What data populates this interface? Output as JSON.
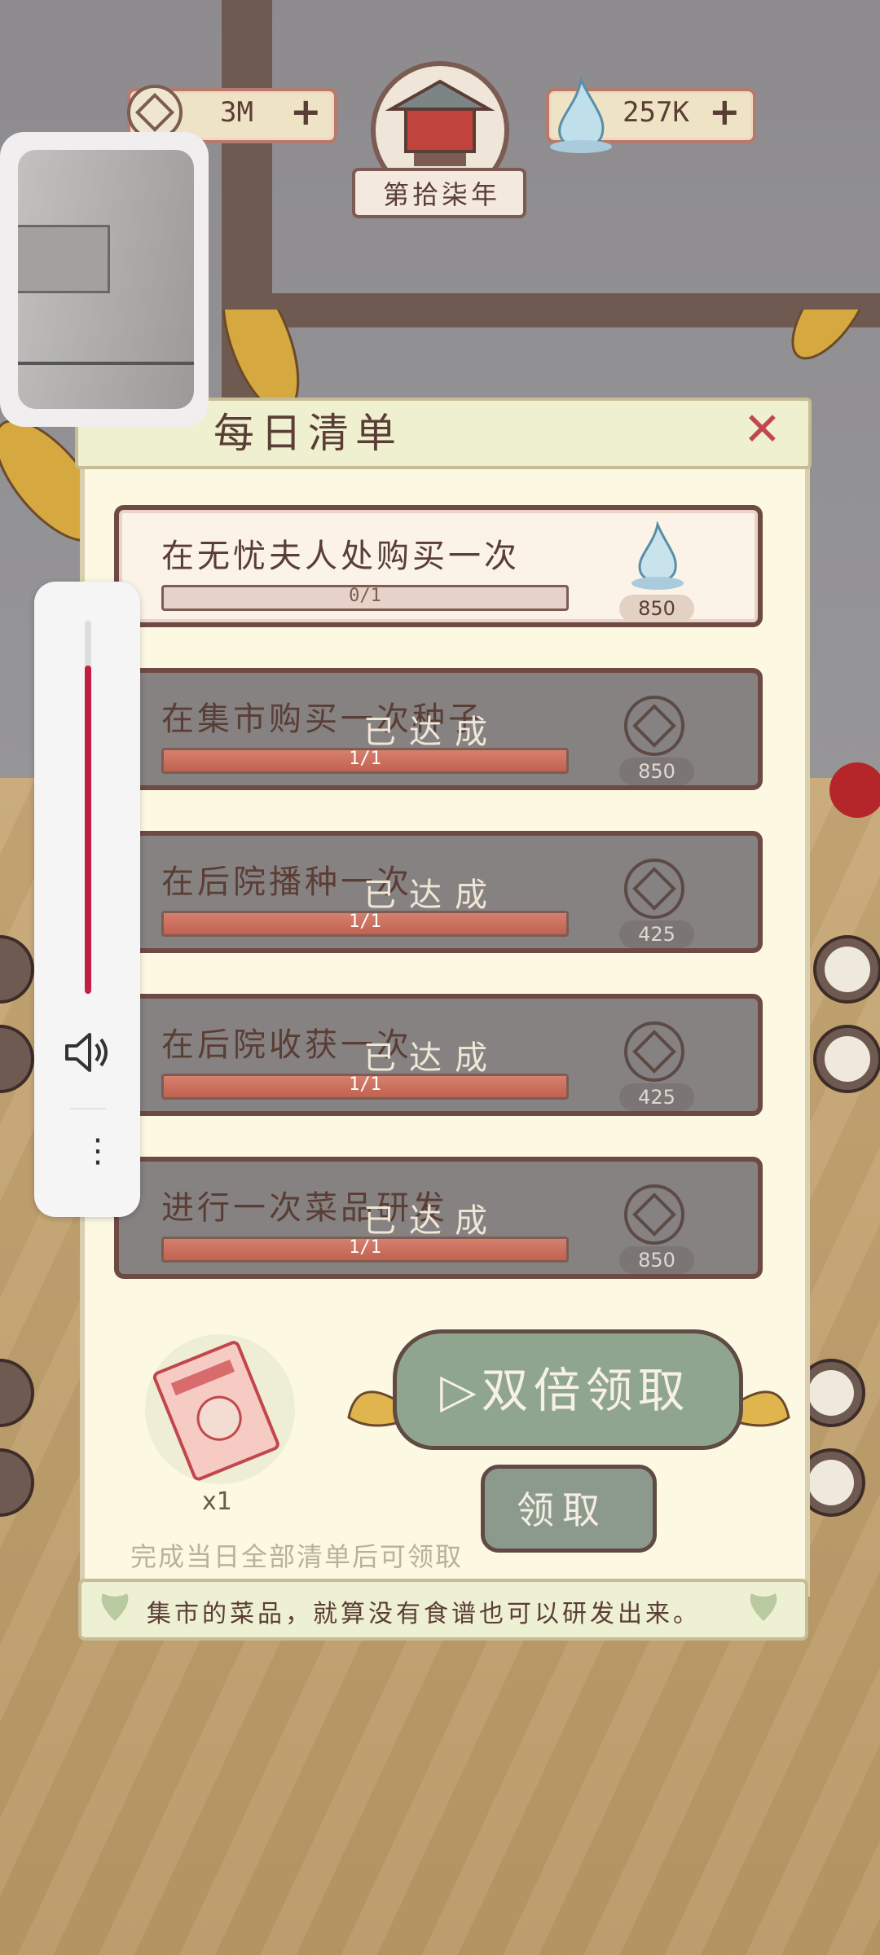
{
  "hud": {
    "coins": "3M",
    "water": "257K",
    "year": "第拾柒年"
  },
  "panel": {
    "title": "每日清单",
    "tasks": [
      {
        "label": "在无忧夫人处购买一次",
        "progress": "0/1",
        "progress_value": 0,
        "reward": "850",
        "reward_icon": "water-drop-icon",
        "status": "active"
      },
      {
        "label": "在集市购买一次种子",
        "progress": "1/1",
        "progress_value": 1,
        "reward": "850",
        "reward_icon": "coin-icon",
        "status": "done"
      },
      {
        "label": "在后院播种一次",
        "progress": "1/1",
        "progress_value": 1,
        "reward": "425",
        "reward_icon": "coin-icon",
        "status": "done"
      },
      {
        "label": "在后院收获一次",
        "progress": "1/1",
        "progress_value": 1,
        "reward": "425",
        "reward_icon": "coin-icon",
        "status": "done"
      },
      {
        "label": "进行一次菜品研发",
        "progress": "1/1",
        "progress_value": 1,
        "reward": "850",
        "reward_icon": "coin-icon",
        "status": "done"
      }
    ],
    "done_stamp": "已达成",
    "bonus_count": "x1",
    "double_claim": "双倍领取",
    "claim": "领取",
    "hint": "完成当日全部清单后可领取"
  },
  "tip": "集市的菜品，就算没有食谱也可以研发出来。",
  "colors": {
    "accent_red": "#c51e46",
    "panel_bg": "#fdf8e2",
    "done_task": "#868282"
  },
  "system": {
    "volume_level": 0.88
  }
}
